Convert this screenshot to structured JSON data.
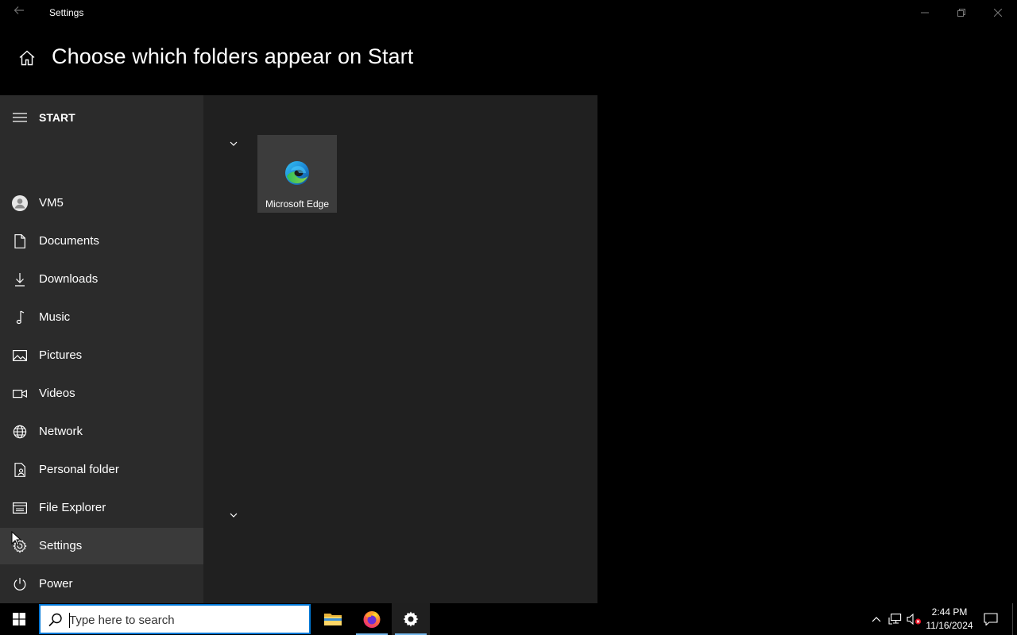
{
  "window": {
    "title": "Settings",
    "icons": {
      "back": "back-arrow-icon",
      "minimize": "minimize-icon",
      "maximize": "restore-icon",
      "close": "close-icon"
    }
  },
  "header": {
    "page_title": "Choose which folders appear on Start",
    "icon": "home-icon"
  },
  "start_menu": {
    "label": "START",
    "items": [
      {
        "label": "VM5",
        "icon": "user-avatar-icon"
      },
      {
        "label": "Documents",
        "icon": "document-icon"
      },
      {
        "label": "Downloads",
        "icon": "download-icon"
      },
      {
        "label": "Music",
        "icon": "music-note-icon"
      },
      {
        "label": "Pictures",
        "icon": "picture-icon"
      },
      {
        "label": "Videos",
        "icon": "video-icon"
      },
      {
        "label": "Network",
        "icon": "network-globe-icon"
      },
      {
        "label": "Personal folder",
        "icon": "personal-folder-icon"
      },
      {
        "label": "File Explorer",
        "icon": "file-explorer-icon"
      },
      {
        "label": "Settings",
        "icon": "gear-icon",
        "selected": true
      },
      {
        "label": "Power",
        "icon": "power-icon"
      }
    ],
    "tile": {
      "label": "Microsoft Edge",
      "icon": "edge-icon"
    }
  },
  "taskbar": {
    "search_placeholder": "Type here to search",
    "apps": [
      {
        "name": "File Explorer",
        "icon": "file-explorer-folder-icon"
      },
      {
        "name": "Firefox",
        "icon": "firefox-icon"
      },
      {
        "name": "Settings",
        "icon": "gear-icon"
      }
    ],
    "time": "2:44 PM",
    "date": "11/16/2024"
  },
  "colors": {
    "background": "#000000",
    "panel": "#202020",
    "rail": "#2b2b2b",
    "selected": "#3a3a3a",
    "accent": "#0078d7",
    "taskbar_underline": "#76b9ed"
  }
}
